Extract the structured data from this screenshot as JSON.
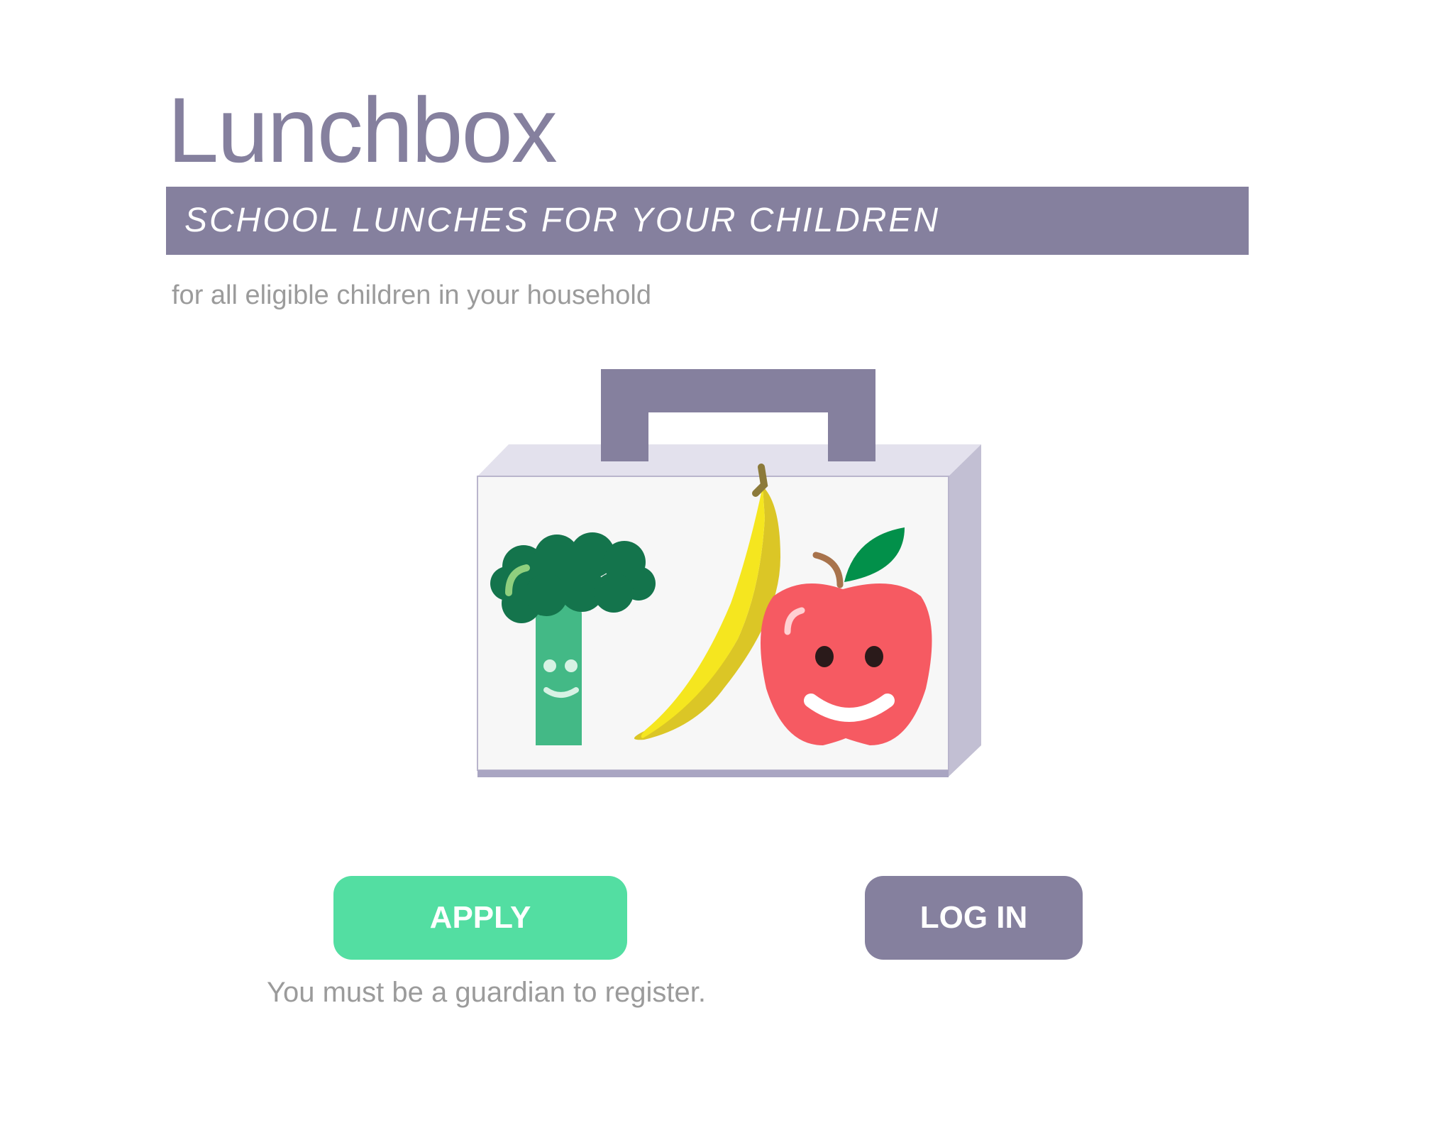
{
  "header": {
    "title": "Lunchbox",
    "banner": "SCHOOL LUNCHES FOR YOUR CHILDREN",
    "subtitle": "for all eligible children in your household"
  },
  "illustration": {
    "icon": "lunchbox-icon",
    "contents": [
      "broccoli-icon",
      "banana-icon",
      "apple-icon"
    ]
  },
  "actions": {
    "apply_label": "APPLY",
    "login_label": "LOG IN",
    "guardian_note": "You must be a guardian to register."
  },
  "colors": {
    "brand": "#85809e",
    "apply": "#53dea2",
    "muted_text": "#9b9b9b"
  }
}
